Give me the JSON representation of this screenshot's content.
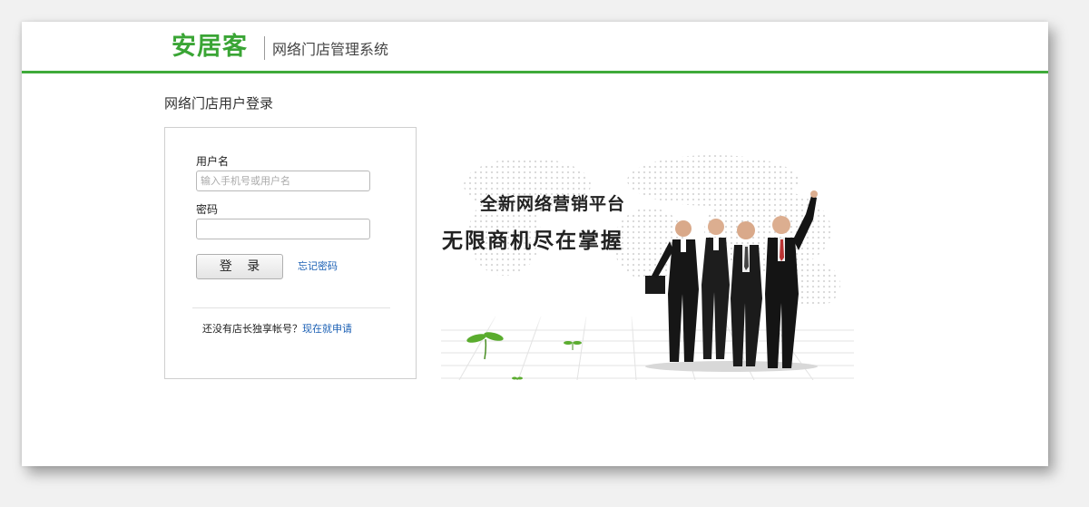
{
  "header": {
    "logo_text": "安居客",
    "system_title": "网络门店管理系统"
  },
  "login": {
    "page_title": "网络门店用户登录",
    "username_label": "用户名",
    "username_placeholder": "输入手机号或用户名",
    "password_label": "密码",
    "login_button": "登 录",
    "forgot_link": "忘记密码",
    "register_prompt": "还没有店长独享帐号？",
    "register_link": "现在就申请"
  },
  "banner": {
    "line1": "全新网络营销平台",
    "line2": "无限商机尽在掌握",
    "image": "business-team-celebration"
  },
  "colors": {
    "brand_green": "#3eaa3a",
    "link_blue": "#1a5fb4"
  }
}
